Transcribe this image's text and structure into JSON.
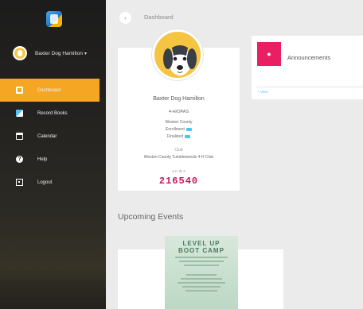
{
  "app": {
    "logo_icon": "app-logo-icon"
  },
  "user": {
    "name": "Baxter Dog Hamilton",
    "caret": "▾"
  },
  "nav": [
    {
      "label": "Dashboard",
      "icon": "dashboard-icon",
      "active": true
    },
    {
      "label": "Record Books",
      "icon": "book-icon",
      "active": false
    },
    {
      "label": "Calendar",
      "icon": "calendar-icon",
      "active": false
    },
    {
      "label": "Help",
      "icon": "help-icon",
      "active": false
    },
    {
      "label": "Logout",
      "icon": "logout-icon",
      "active": false
    }
  ],
  "topbar": {
    "back_glyph": "‹",
    "breadcrumb": "Dashboard"
  },
  "profile": {
    "name": "Baxter Dog Hamilton",
    "role": "4-H/OPAS",
    "county": "Weston County",
    "tag1": "Enrollment",
    "tag2": "Finalized",
    "club_label": "Club",
    "club": "Weston County Tumbleweeds 4-H Club",
    "id_label": "4-H ID #",
    "id": "216540"
  },
  "announcements": {
    "title": "Announcements",
    "link": "+ View",
    "icon": "bell-icon"
  },
  "events": {
    "title": "Upcoming Events",
    "flyer_title_1": "LEVEL UP",
    "flyer_title_2": "BOOT CAMP"
  },
  "colors": {
    "accent": "#f5a623",
    "pink": "#e91e63",
    "id": "#c2185b",
    "link": "#4fc3f7"
  }
}
